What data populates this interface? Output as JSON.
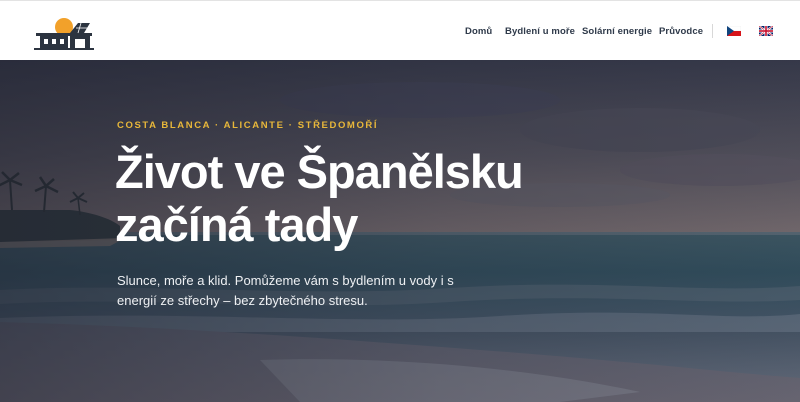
{
  "brand": {
    "logo": "house-solar-logo"
  },
  "nav": {
    "items": [
      {
        "label": "Domů"
      },
      {
        "label": "Bydlení u moře"
      },
      {
        "label": "Solární energie"
      },
      {
        "label": "Průvodce"
      }
    ],
    "languages": [
      {
        "icon": "czech-flag-icon"
      },
      {
        "icon": "uk-flag-icon"
      }
    ]
  },
  "hero": {
    "eyebrow": "COSTA BLANCA · ALICANTE · STŘEDOMOŘÍ",
    "headline_line1": "Život ve Španělsku",
    "headline_line2": "začíná tady",
    "subtitle": "Slunce, moře a klid. Pomůžeme vám s bydlením u vody i s energií ze střechy – bez zbytečného stresu."
  },
  "colors": {
    "accent": "#e8b73a",
    "nav_text": "#2f3a4a",
    "headline": "#ffffff"
  }
}
